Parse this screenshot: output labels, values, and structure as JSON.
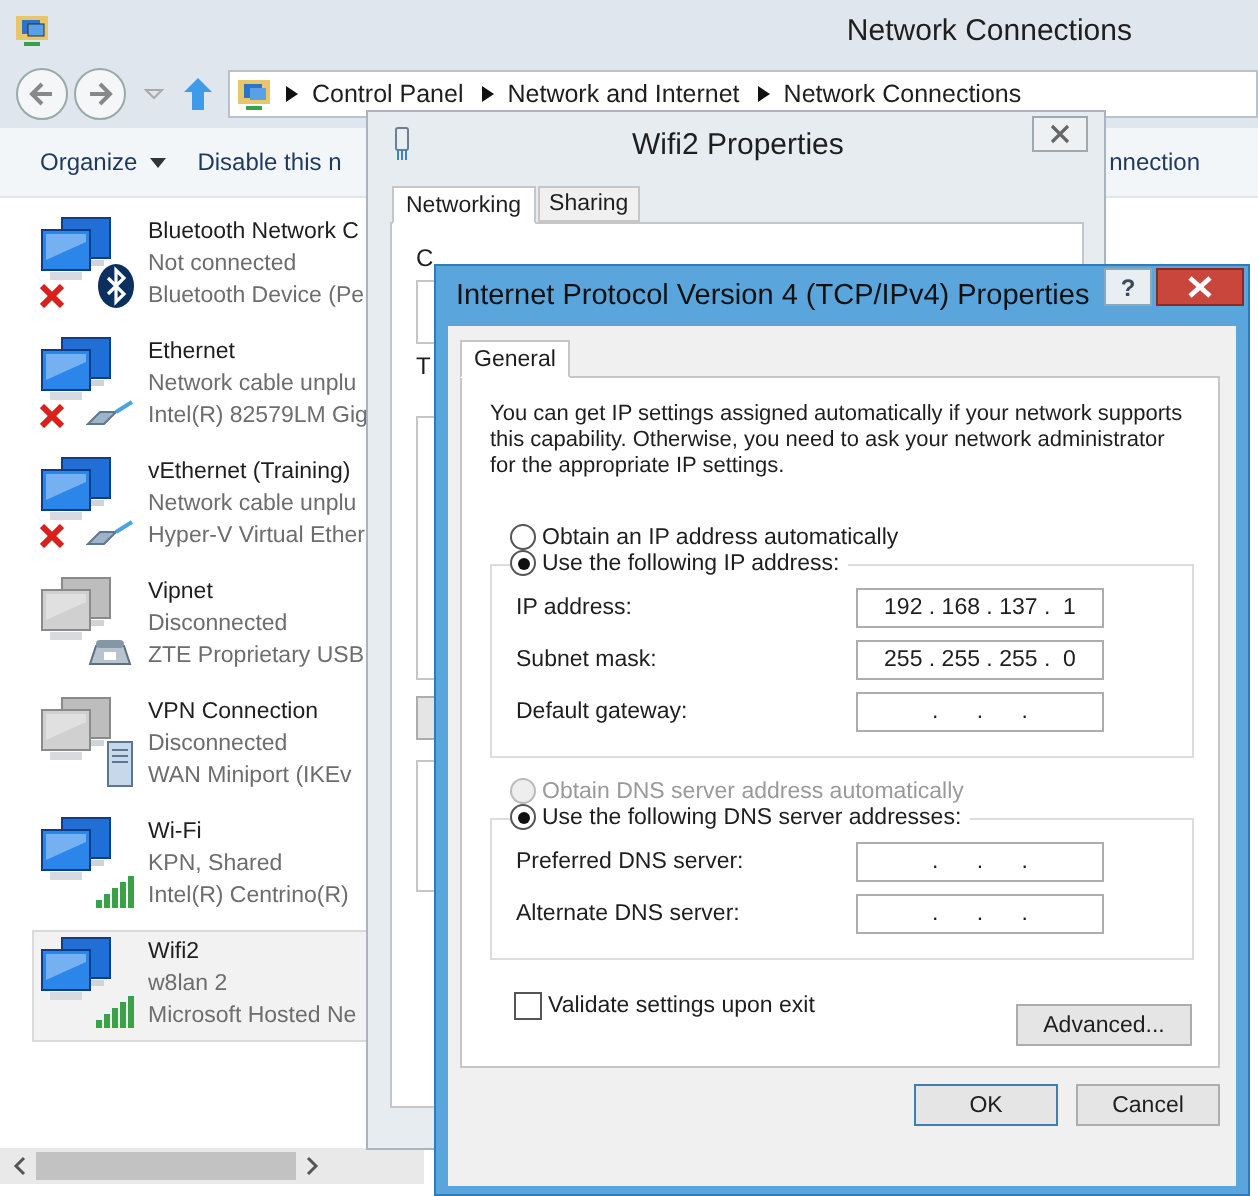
{
  "window": {
    "title": "Network Connections"
  },
  "address_bar": {
    "breadcrumbs": [
      "Control Panel",
      "Network and Internet",
      "Network Connections"
    ]
  },
  "toolbar": {
    "items": [
      {
        "label": "Organize",
        "dropdown": true
      },
      {
        "label": "Disable this n",
        "dropdown": false
      }
    ],
    "trailing": "nnection"
  },
  "connections": [
    {
      "name": "Bluetooth Network C",
      "status": "Not connected",
      "device": "Bluetooth Device (Pe",
      "kind": "bluetooth",
      "error": true,
      "active": true,
      "selected": false
    },
    {
      "name": "Ethernet",
      "status": "Network cable unplu",
      "device": "Intel(R) 82579LM Gig",
      "kind": "cable",
      "error": true,
      "active": true,
      "selected": false
    },
    {
      "name": "vEthernet (Training)",
      "status": "Network cable unplu",
      "device": "Hyper-V Virtual Ether",
      "kind": "cable",
      "error": true,
      "active": true,
      "selected": false
    },
    {
      "name": "Vipnet",
      "status": "Disconnected",
      "device": "ZTE Proprietary USB",
      "kind": "modem",
      "error": false,
      "active": false,
      "selected": false
    },
    {
      "name": "VPN Connection",
      "status": "Disconnected",
      "device": "WAN Miniport (IKEv",
      "kind": "server",
      "error": false,
      "active": false,
      "selected": false
    },
    {
      "name": "Wi-Fi",
      "status": "KPN, Shared",
      "device": "Intel(R) Centrino(R)",
      "kind": "signal",
      "error": false,
      "active": true,
      "selected": false
    },
    {
      "name": "Wifi2",
      "status": "w8lan  2",
      "device": "Microsoft Hosted Ne",
      "kind": "signal",
      "error": false,
      "active": true,
      "selected": true
    }
  ],
  "wifi2_dialog": {
    "title": "Wifi2 Properties",
    "tabs": [
      {
        "label": "Networking",
        "selected": true
      },
      {
        "label": "Sharing",
        "selected": false
      }
    ],
    "labels": [
      "C",
      "T"
    ]
  },
  "ipv4_dialog": {
    "title": "Internet Protocol Version 4 (TCP/IPv4) Properties",
    "help": "?",
    "tabs": [
      {
        "label": "General",
        "selected": true
      }
    ],
    "intro": "You can get IP settings assigned automatically if your network supports this capability. Otherwise, you need to ask your network administrator for the appropriate IP settings.",
    "ip_options": [
      {
        "label": "Obtain an IP address automatically",
        "selected": false,
        "disabled": false
      },
      {
        "label": "Use the following IP address:",
        "selected": true,
        "disabled": false
      }
    ],
    "ip_fields": [
      {
        "label": "IP address:",
        "value": "192 . 168 . 137 .  1"
      },
      {
        "label": "Subnet mask:",
        "value": "255 . 255 . 255 .  0"
      },
      {
        "label": "Default gateway:",
        "value": ".      .      ."
      }
    ],
    "dns_options": [
      {
        "label": "Obtain DNS server address automatically",
        "selected": false,
        "disabled": true
      },
      {
        "label": "Use the following DNS server addresses:",
        "selected": true,
        "disabled": false
      }
    ],
    "dns_fields": [
      {
        "label": "Preferred DNS server:",
        "value": ".      .      ."
      },
      {
        "label": "Alternate DNS server:",
        "value": ".      .      ."
      }
    ],
    "validate": {
      "label": "Validate settings upon exit",
      "checked": false
    },
    "advanced": "Advanced...",
    "ok": "OK",
    "cancel": "Cancel"
  }
}
